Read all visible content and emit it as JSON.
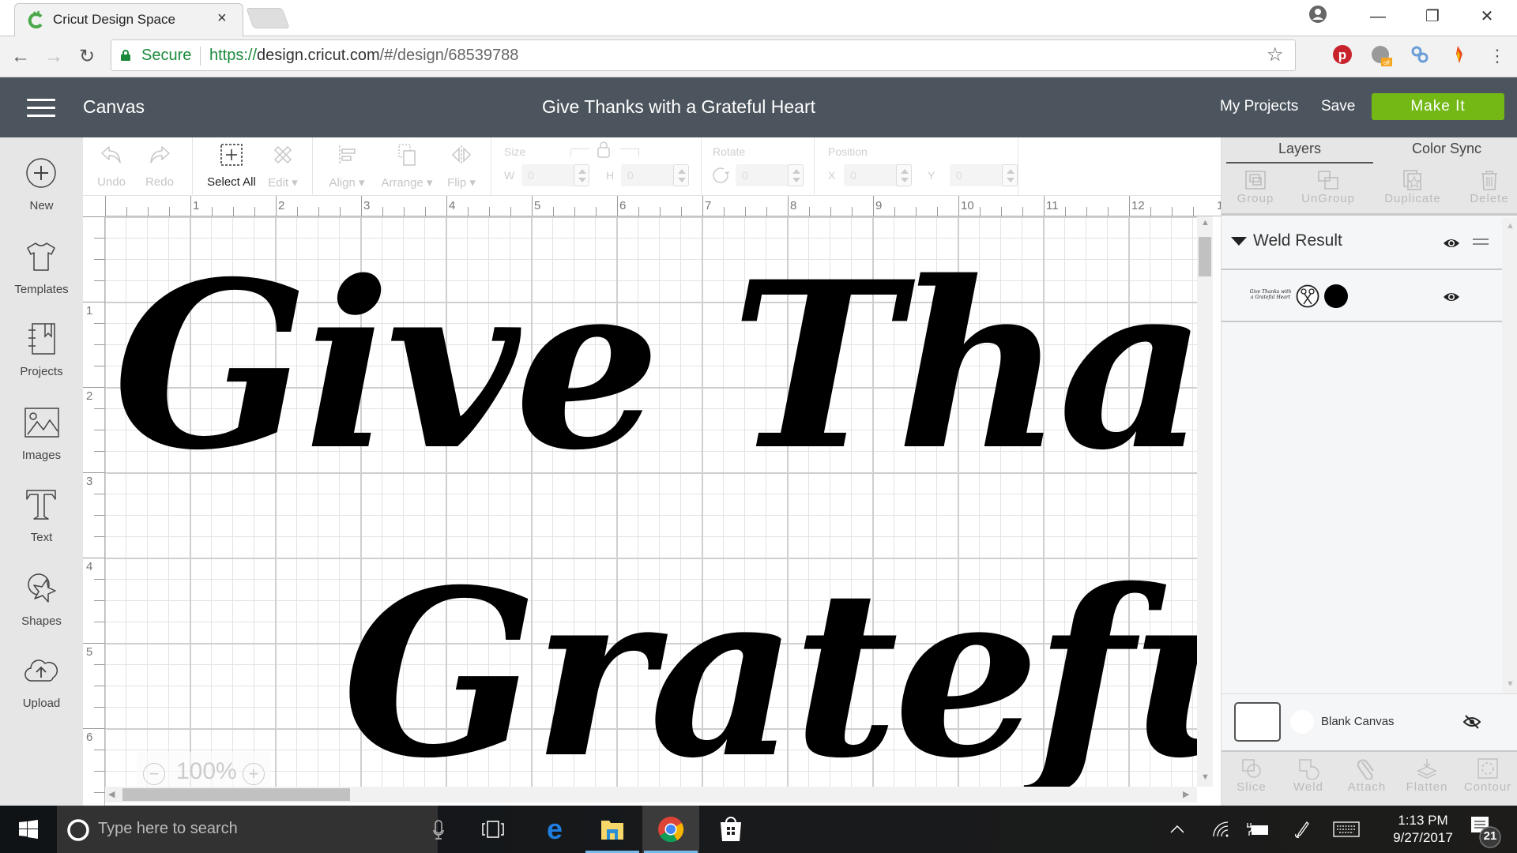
{
  "browser": {
    "tab_title": "Cricut Design Space",
    "tab_close": "×",
    "secure_label": "Secure",
    "url_scheme": "https://",
    "url_host": "design.cricut.com",
    "url_path": "/#/design/68539788",
    "window_controls": {
      "minimize": "—",
      "restore": "❐",
      "close": "✕"
    },
    "extensions": [
      "pinterest-icon",
      "grammarly-off-icon",
      "link-icon",
      "flame-icon",
      "menu-kebab-icon"
    ],
    "extension_badge": "off"
  },
  "header": {
    "app_section": "Canvas",
    "project_title": "Give Thanks with a Grateful Heart",
    "my_projects": "My Projects",
    "save": "Save",
    "make_it": "Make It",
    "make_it_color": "#73b815",
    "header_color": "#4c555e"
  },
  "sidebar": {
    "items": [
      {
        "label": "New",
        "icon": "plus-circle-icon"
      },
      {
        "label": "Templates",
        "icon": "tshirt-icon"
      },
      {
        "label": "Projects",
        "icon": "notebook-icon"
      },
      {
        "label": "Images",
        "icon": "image-icon"
      },
      {
        "label": "Text",
        "icon": "text-t-icon"
      },
      {
        "label": "Shapes",
        "icon": "shapes-icon"
      },
      {
        "label": "Upload",
        "icon": "cloud-upload-icon"
      }
    ]
  },
  "toolbar": {
    "undo": "Undo",
    "redo": "Redo",
    "select_all": "Select All",
    "edit": "Edit",
    "align": "Align",
    "arrange": "Arrange",
    "flip": "Flip",
    "size_label": "Size",
    "w_label": "W",
    "h_label": "H",
    "w_value": "0",
    "h_value": "0",
    "rotate_label": "Rotate",
    "rotate_value": "0",
    "position_label": "Position",
    "x_label": "X",
    "y_label": "Y",
    "x_value": "0",
    "y_value": "0"
  },
  "canvas": {
    "ruler_x": [
      "1",
      "2",
      "3",
      "4",
      "5",
      "6",
      "7",
      "8",
      "9",
      "10",
      "11",
      "12",
      "1"
    ],
    "ruler_y": [
      "1",
      "2",
      "3",
      "4",
      "5",
      "6"
    ],
    "design_line1": "Give Thanks",
    "design_line2": "Grateful",
    "zoom_level": "100%",
    "zoom_out": "−",
    "zoom_in": "+"
  },
  "right_panel": {
    "tabs": [
      "Layers",
      "Color Sync"
    ],
    "active_tab": "Layers",
    "tools": [
      "Group",
      "UnGroup",
      "Duplicate",
      "Delete"
    ],
    "group_name": "Weld Result",
    "layer_thumb_text": "Give Thanks with a Grateful Heart",
    "blank_canvas": "Blank Canvas",
    "bottom_tools": [
      "Slice",
      "Weld",
      "Attach",
      "Flatten",
      "Contour"
    ]
  },
  "taskbar": {
    "search_placeholder": "Type here to search",
    "time": "1:13 PM",
    "date": "9/27/2017",
    "notification_count": "21"
  }
}
